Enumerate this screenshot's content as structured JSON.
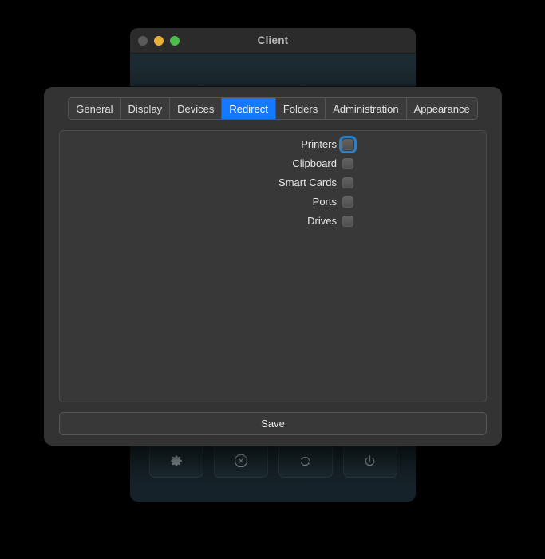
{
  "client_window": {
    "title": "Client",
    "traffic_lights": [
      {
        "name": "close",
        "color": "#5a5a5a"
      },
      {
        "name": "minimize",
        "color": "#e9b036"
      },
      {
        "name": "maximize",
        "color": "#4cbd4a"
      }
    ],
    "toolbar": {
      "buttons": [
        {
          "icon": "gear-icon",
          "label": "Settings"
        },
        {
          "icon": "cancel-octagon-icon",
          "label": "Disconnect"
        },
        {
          "icon": "refresh-icon",
          "label": "Refresh"
        },
        {
          "icon": "power-icon",
          "label": "Power"
        }
      ]
    }
  },
  "dialog": {
    "tabs": [
      {
        "label": "General",
        "active": false
      },
      {
        "label": "Display",
        "active": false
      },
      {
        "label": "Devices",
        "active": false
      },
      {
        "label": "Redirect",
        "active": true
      },
      {
        "label": "Folders",
        "active": false
      },
      {
        "label": "Administration",
        "active": false
      },
      {
        "label": "Appearance",
        "active": false
      }
    ],
    "active_tab": "Redirect",
    "redirect_options": [
      {
        "label": "Printers",
        "checked": false,
        "focused": true
      },
      {
        "label": "Clipboard",
        "checked": false,
        "focused": false
      },
      {
        "label": "Smart Cards",
        "checked": false,
        "focused": false
      },
      {
        "label": "Ports",
        "checked": false,
        "focused": false
      },
      {
        "label": "Drives",
        "checked": false,
        "focused": false
      }
    ],
    "save_label": "Save",
    "accent_color": "#1479ff",
    "focus_ring_color": "#2f7fc4"
  }
}
